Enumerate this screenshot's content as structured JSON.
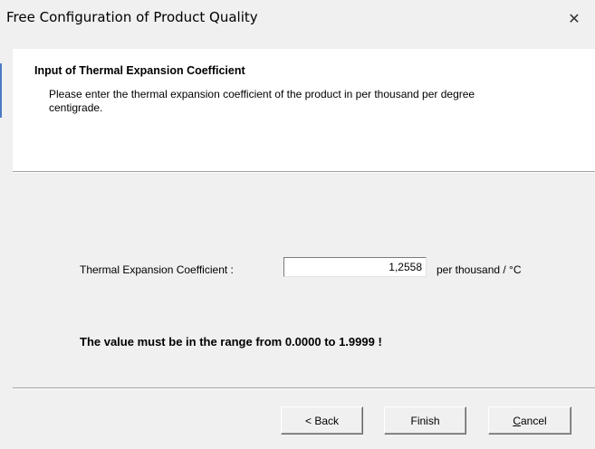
{
  "window": {
    "title": "Free Configuration of Product Quality",
    "close_glyph": "✕"
  },
  "header": {
    "heading": "Input of Thermal Expansion Coefficient",
    "description": "Please enter the thermal expansion coefficient of the product in per thousand per degree centigrade."
  },
  "form": {
    "label": "Thermal Expansion Coefficient :",
    "value": "1,2558",
    "unit": "per thousand / °C"
  },
  "note": "The value must be in the range from 0.0000 to 1.9999 !",
  "buttons": {
    "back": "< Back",
    "finish": "Finish",
    "cancel_mnemonic": "C",
    "cancel_rest": "ancel"
  },
  "icons": {
    "close": "close-icon"
  }
}
